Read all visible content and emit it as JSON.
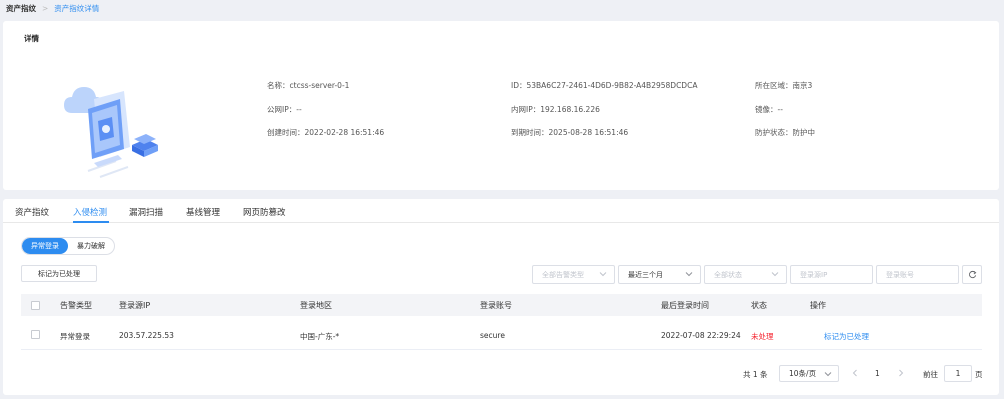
{
  "breadcrumb": {
    "root": "资产指纹",
    "separator": ">",
    "current": "资产指纹详情"
  },
  "detail": {
    "title": "详情",
    "fields": {
      "name": "名称：ctcss-server-0-1",
      "id": "ID：53BA6C27-2461-4D6D-9B82-A4B2958DCDCA",
      "region": "所在区域：南京3",
      "public_ip": "公网IP：--",
      "private_ip": "内网IP：192.168.16.226",
      "image": "镜像：--",
      "created": "创建时间：2022-02-28 16:51:46",
      "expires": "到期时间：2025-08-28 16:51:46",
      "protection": "防护状态：防护中"
    }
  },
  "tabs": [
    "资产指纹",
    "入侵检测",
    "漏洞扫描",
    "基线管理",
    "网页防篡改"
  ],
  "active_tab": 1,
  "segments": {
    "on": "异常登录",
    "off": "暴力破解"
  },
  "mark_button": "标记为已处理",
  "filters": {
    "alert_type": "全部告警类型",
    "time_range": "最近三个月",
    "status": "全部状态",
    "login_ip": "登录源IP",
    "login_account": "登录账号"
  },
  "table": {
    "headers": [
      "告警类型",
      "登录源IP",
      "登录地区",
      "登录账号",
      "最后登录时间",
      "状态",
      "操作"
    ],
    "rows": [
      {
        "type": "异常登录",
        "ip": "203.57.225.53",
        "region": "中国-广东-*",
        "account": "secure",
        "time": "2022-07-08 22:29:24",
        "status": "未处理",
        "action": "标记为已处理"
      }
    ]
  },
  "pagination": {
    "total": "共 1 条",
    "page_size": "10条/页",
    "current_page": "1",
    "goto_prefix": "前往",
    "goto_value": "1",
    "goto_suffix": "页"
  },
  "colors": {
    "accent": "#2d8cf0",
    "danger": "#f5222d",
    "bg": "#eef0f5"
  }
}
